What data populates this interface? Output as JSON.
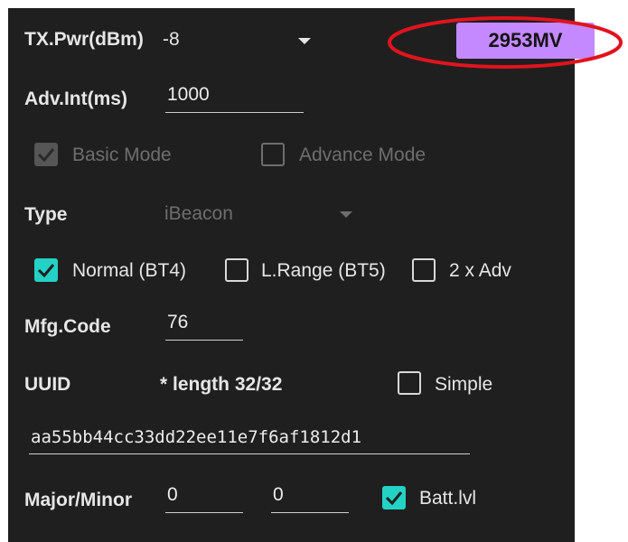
{
  "tx_power": {
    "label": "TX.Pwr(dBm)",
    "value": "-8"
  },
  "voltage_button": {
    "label": "2953MV"
  },
  "adv_interval": {
    "label": "Adv.Int(ms)",
    "value": "1000"
  },
  "mode": {
    "basic_label": "Basic Mode",
    "basic_checked": true,
    "advance_label": "Advance Mode",
    "advance_checked": false
  },
  "type": {
    "label": "Type",
    "value": "iBeacon"
  },
  "phy": {
    "normal_label": "Normal (BT4)",
    "normal_checked": true,
    "long_range_label": "L.Range (BT5)",
    "long_range_checked": false,
    "double_adv_label": "2 x Adv",
    "double_adv_checked": false
  },
  "mfg_code": {
    "label": "Mfg.Code",
    "value": "76"
  },
  "uuid": {
    "label": "UUID",
    "length_text": "* length 32/32",
    "simple_label": "Simple",
    "simple_checked": false,
    "value": "aa55bb44cc33dd22ee11e7f6af1812d1"
  },
  "major_minor": {
    "label": "Major/Minor",
    "major": "0",
    "minor": "0",
    "batt_label": "Batt.lvl",
    "batt_checked": true
  },
  "colors": {
    "background": "#1f1f1f",
    "accent_checkbox": "#24d1c5",
    "voltage_button": "#c489ff",
    "highlight_ellipse": "#e0141e"
  }
}
